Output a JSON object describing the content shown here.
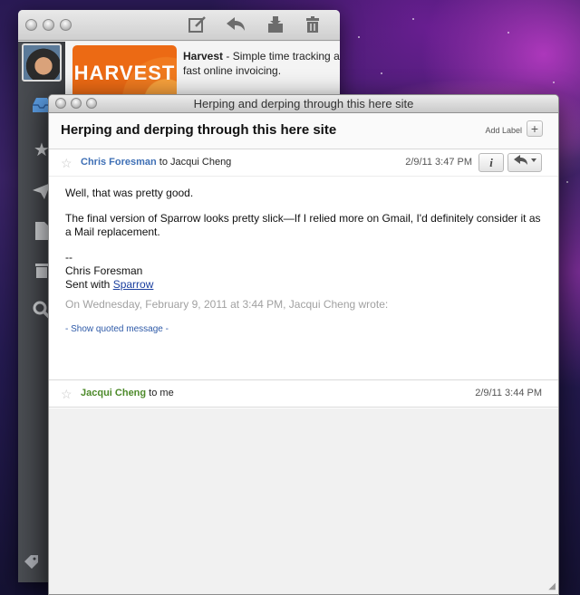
{
  "back_window": {
    "harvest_name": "Harvest",
    "harvest_desc": " - Simple time tracking and fast online invoicing.",
    "harvest_logo_text": "HARVEST",
    "toolbar_icons": [
      "compose-icon",
      "reply-icon",
      "archive-icon",
      "trash-icon"
    ],
    "sidebar_icons": [
      "inbox-icon",
      "star-icon",
      "sent-icon",
      "drafts-icon",
      "trash-icon",
      "search-icon",
      "tag-icon"
    ]
  },
  "front_window": {
    "title": "Herping and derping through this here site",
    "subject": "Herping and derping through this here site",
    "add_label": "Add Label",
    "add_label_btn": "+",
    "messages": [
      {
        "sender": "Chris Foresman",
        "to_text": " to Jacqui Cheng",
        "date": "2/9/11 3:47 PM",
        "body_p1": "Well, that was pretty good.",
        "body_p2": "The final version of Sparrow looks pretty slick—If I relied more on Gmail, I'd definitely consider it as a Mail replacement.",
        "sig_dash": "--",
        "sig_name": "Chris Foresman",
        "sig_sent": "Sent with ",
        "sig_link": "Sparrow",
        "quote_intro": "On Wednesday, February 9, 2011 at 3:44 PM, Jacqui Cheng wrote:",
        "show_quoted": "- Show quoted message -"
      },
      {
        "sender": "Jacqui Cheng",
        "to_text": " to me",
        "date": "2/9/11 3:44 PM"
      }
    ]
  },
  "colors": {
    "sender_blue": "#3e6fb5",
    "sender_green": "#4d8a2a",
    "link": "#1a3e9e",
    "harvest_orange": "#ec6a14"
  }
}
